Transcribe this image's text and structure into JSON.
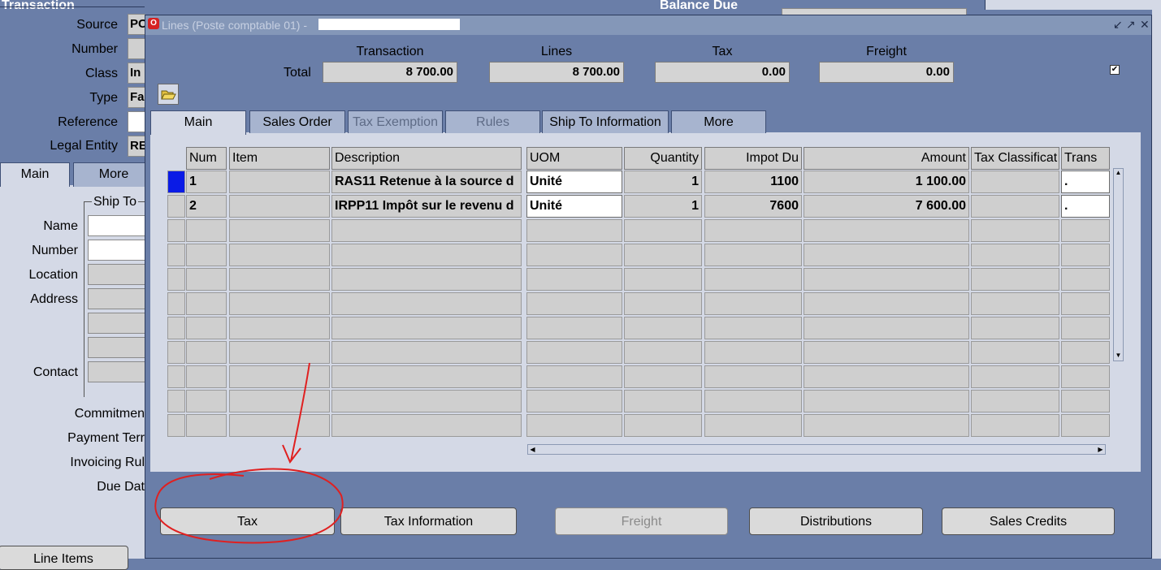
{
  "background_form": {
    "title": "Transaction",
    "balance_due_label": "Balance Due",
    "fields": [
      {
        "label": "Source",
        "value": "PC"
      },
      {
        "label": "Number",
        "value": ""
      },
      {
        "label": "Class",
        "value": "In"
      },
      {
        "label": "Type",
        "value": "Fa"
      },
      {
        "label": "Reference",
        "value": ""
      },
      {
        "label": "Legal Entity",
        "value": "RE"
      }
    ],
    "tabs": [
      {
        "label": "Main"
      },
      {
        "label": "More"
      }
    ],
    "ship_to_label": "Ship To",
    "ship_fields": [
      "Name",
      "Number",
      "Location",
      "Address",
      "Contact"
    ],
    "lower_labels": [
      "Commitmen",
      "Payment Terr",
      "Invoicing Rul",
      "Due Dat"
    ],
    "line_items_button": "Line Items"
  },
  "window": {
    "title": "Lines (Poste comptable 01) - "
  },
  "totals": {
    "row_label": "Total",
    "columns": [
      {
        "label": "Transaction",
        "value": "8 700.00"
      },
      {
        "label": "Lines",
        "value": "8 700.00"
      },
      {
        "label": "Tax",
        "value": "0.00"
      },
      {
        "label": "Freight",
        "value": "0.00"
      }
    ],
    "checkbox_mark": "✔"
  },
  "tabs": [
    {
      "label": "Main",
      "state": "active"
    },
    {
      "label": "Sales Order",
      "state": "enabled"
    },
    {
      "label": "Tax Exemption",
      "state": "disabled"
    },
    {
      "label": "Rules",
      "state": "disabled"
    },
    {
      "label": "Ship To Information",
      "state": "enabled"
    },
    {
      "label": "More",
      "state": "enabled"
    }
  ],
  "grid": {
    "headers": [
      "Num",
      "Item",
      "Description",
      "UOM",
      "Quantity",
      "Impot Du",
      "Amount",
      "Tax Classificat",
      "Trans"
    ],
    "rows": [
      {
        "num": "1",
        "item": "",
        "description": "RAS11 Retenue à la source d",
        "uom": "Unité",
        "quantity": "1",
        "impot_du": "1100",
        "amount": "1 100.00",
        "tax_class": "",
        "trans": "."
      },
      {
        "num": "2",
        "item": "",
        "description": "IRPP11 Impôt sur le revenu d",
        "uom": "Unité",
        "quantity": "1",
        "impot_du": "7600",
        "amount": "7 600.00",
        "tax_class": "",
        "trans": "."
      }
    ],
    "empty_rows": 9
  },
  "buttons": [
    {
      "label": "Tax",
      "state": "enabled"
    },
    {
      "label": "Tax Information",
      "state": "enabled"
    },
    {
      "label": "Freight",
      "state": "disabled"
    },
    {
      "label": "Distributions",
      "state": "enabled"
    },
    {
      "label": "Sales Credits",
      "state": "enabled"
    }
  ],
  "annotation_color": "#e02020"
}
